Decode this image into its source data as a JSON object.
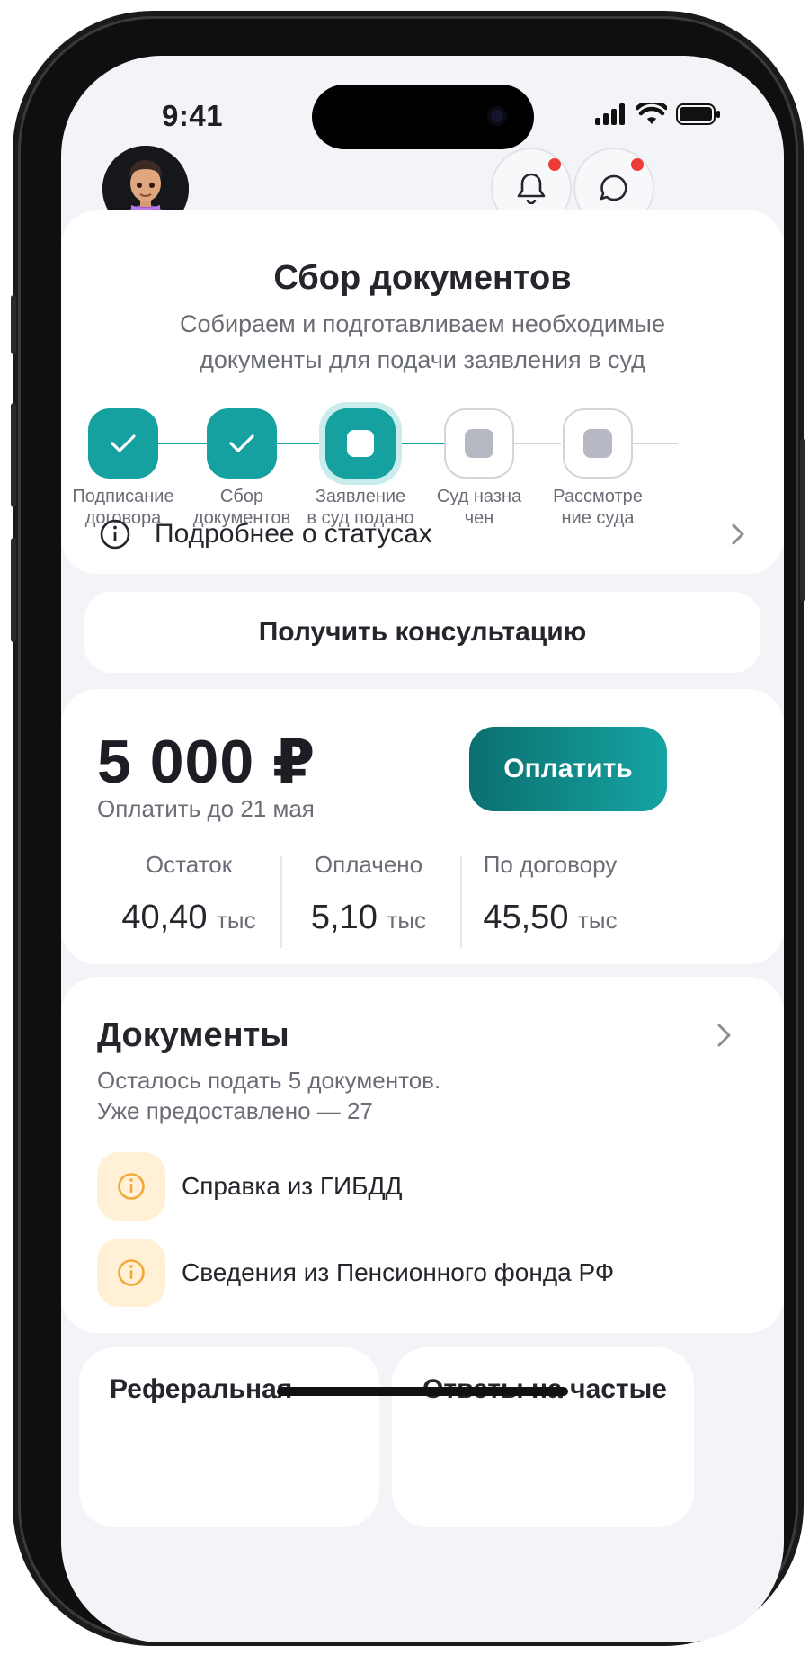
{
  "status_bar": {
    "time": "9:41"
  },
  "header": {
    "avatar_alt": "avatar",
    "has_notifications": true,
    "has_messages": true
  },
  "stage": {
    "title": "Сбор документов",
    "subtitle": "Собираем и подготавливаем необходимые документы для подачи заявления в суд",
    "steps": [
      {
        "label": "Подписание договора",
        "state": "done"
      },
      {
        "label": "Сбор документов",
        "state": "done"
      },
      {
        "label": "Заявление в суд подано",
        "state": "current"
      },
      {
        "label": "Суд назначен",
        "state": "pending"
      },
      {
        "label": "Рассмотрение суда",
        "state": "pending"
      }
    ],
    "step_labels_display": [
      [
        "Подписание",
        "договора"
      ],
      [
        "Сбор",
        "документов"
      ],
      [
        "Заявление",
        "в суд подано"
      ],
      [
        "Суд назна",
        "чен"
      ],
      [
        "Рассмотре",
        "ние суда"
      ]
    ],
    "details_link": "Подробнее о статусах"
  },
  "consultation": {
    "label": "Получить консультацию"
  },
  "payment": {
    "amount": "5 000 ₽",
    "due": "Оплатить до 21 мая",
    "pay_button": "Оплатить",
    "stats": [
      {
        "caption": "Остаток",
        "value": "40,40",
        "unit": "тыс"
      },
      {
        "caption": "Оплачено",
        "value": "5,10",
        "unit": "тыс"
      },
      {
        "caption": "По договору",
        "value": "45,50",
        "unit": "тыс"
      }
    ]
  },
  "documents": {
    "title": "Документы",
    "remaining": "Осталось подать 5 документов.",
    "provided": "Уже предоставлено — 27",
    "items": [
      {
        "name": "Справка из ГИБДД",
        "icon": "info-icon"
      },
      {
        "name": "Сведения из Пенсионного фонда РФ",
        "icon": "info-icon"
      }
    ]
  },
  "bottom_cards": [
    {
      "title": "Реферальная"
    },
    {
      "title": "Ответы на частые"
    }
  ],
  "colors": {
    "accent": "#14a1a0",
    "accent_dark": "#0b6f6f",
    "warning_bg": "#fff0d6",
    "warning_icon": "#f2a93b",
    "badge": "#ef3b36"
  }
}
